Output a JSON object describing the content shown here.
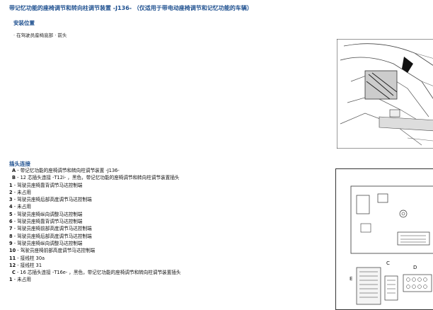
{
  "header": {
    "title": "带记忆功能的座椅调节和转向柱调节装置 -J136- （仅适用于带电动座椅调节和记忆功能的车辆）",
    "install_label": "安装位置",
    "install_note": "· 在驾驶员座椅底部 · 前头"
  },
  "connector": {
    "heading": "插头连接",
    "items": [
      {
        "code": "A",
        "text": " - 带记忆功能的座椅调节和转向柱调节装置 -J136-"
      },
      {
        "code": "B",
        "text": " - 12 芯插头连接 -T12i- ，黑色，带记忆功能的座椅调节和转向柱调节装置插头"
      },
      {
        "code": "1",
        "text": " - 驾驶员座椅靠背调节马达控制端"
      },
      {
        "code": "2",
        "text": " - 未占用"
      },
      {
        "code": "3",
        "text": " - 驾驶员座椅后部高度调节马达控制端"
      },
      {
        "code": "4",
        "text": " - 未占用"
      },
      {
        "code": "5",
        "text": " - 驾驶员座椅纵向调整马达控制端"
      },
      {
        "code": "6",
        "text": " - 驾驶员座椅靠背调节马达控制端"
      },
      {
        "code": "7",
        "text": " - 驾驶员座椅前部高度调节马达控制端"
      },
      {
        "code": "8",
        "text": " - 驾驶员座椅后部高度调节马达控制端"
      },
      {
        "code": "9",
        "text": " - 驾驶员座椅纵向调整马达控制端"
      },
      {
        "code": "10",
        "text": " - 驾驶员座椅前部高度调节马达控制端"
      },
      {
        "code": "11",
        "text": " - 接线柱 30a"
      },
      {
        "code": "12",
        "text": " - 接线柱 31"
      },
      {
        "code": "C",
        "text": " - 16 芯插头连接 -T16e- ，黑色，带记忆功能的座椅调节和转向柱调节装置插头"
      },
      {
        "code": "1",
        "text": " - 未占用"
      }
    ]
  },
  "figure2": {
    "label_c": "C",
    "label_d": "D",
    "label_e": "E"
  }
}
